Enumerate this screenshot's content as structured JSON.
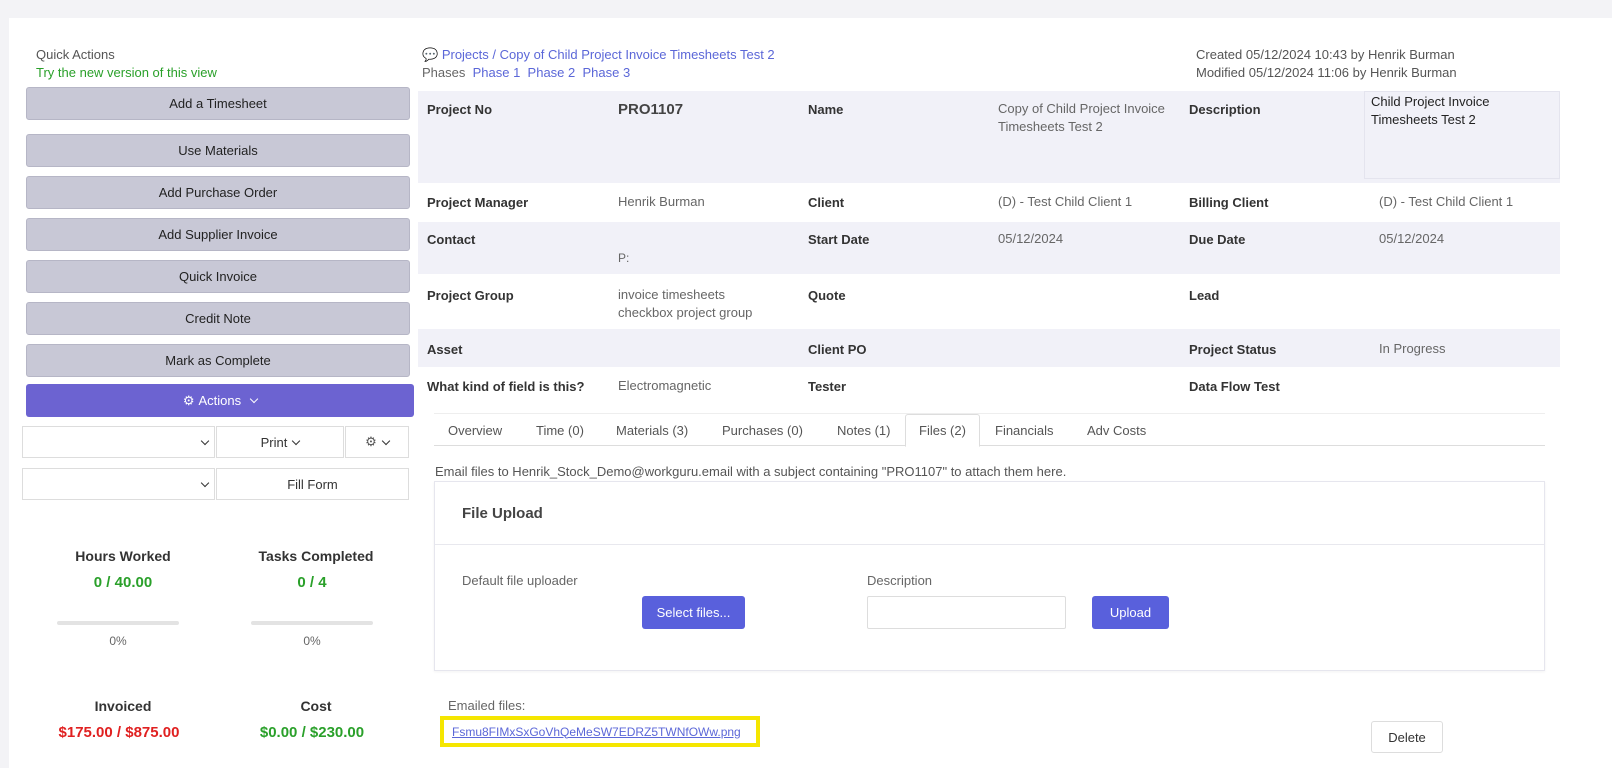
{
  "quick_actions": {
    "title": "Quick Actions",
    "try_new": "Try the new version of this view",
    "buttons": [
      "Add a Timesheet",
      "Use Materials",
      "Add Purchase Order",
      "Add Supplier Invoice",
      "Quick Invoice",
      "Credit Note",
      "Mark as Complete"
    ],
    "actions_label": "Actions",
    "print_label": "Print",
    "fill_form_label": "Fill Form"
  },
  "stats": {
    "hours_worked": {
      "label": "Hours Worked",
      "value": "0 / 40.00",
      "pct": "0%"
    },
    "tasks_completed": {
      "label": "Tasks Completed",
      "value": "0 / 4",
      "pct": "0%"
    },
    "invoiced": {
      "label": "Invoiced",
      "value": "$175.00 / $875.00"
    },
    "cost": {
      "label": "Cost",
      "value": "$0.00 / $230.00"
    }
  },
  "header": {
    "breadcrumb": "Projects / Copy of Child Project Invoice Timesheets Test 2",
    "phases_label": "Phases",
    "phases": [
      "Phase 1",
      "Phase 2",
      "Phase 3"
    ],
    "created": "Created 05/12/2024 10:43 by Henrik Burman",
    "modified": "Modified 05/12/2024 11:06 by Henrik Burman"
  },
  "details": {
    "project_no_label": "Project No",
    "project_no": "PRO1107",
    "name_label": "Name",
    "name": "Copy of Child Project Invoice Timesheets Test 2",
    "description_label": "Description",
    "description": "Child Project Invoice Timesheets Test 2",
    "manager_label": "Project Manager",
    "manager": "Henrik Burman",
    "client_label": "Client",
    "client": "(D) - Test Child Client 1",
    "billing_client_label": "Billing Client",
    "billing_client": "(D) - Test Child Client 1",
    "contact_label": "Contact",
    "contact_phone": "P:",
    "start_date_label": "Start Date",
    "start_date": "05/12/2024",
    "due_date_label": "Due Date",
    "due_date": "05/12/2024",
    "group_label": "Project Group",
    "group_1": "invoice timesheets",
    "group_2": "checkbox project group",
    "quote_label": "Quote",
    "lead_label": "Lead",
    "asset_label": "Asset",
    "client_po_label": "Client PO",
    "status_label": "Project Status",
    "status": "In Progress",
    "field_kind_label": "What kind of field is this?",
    "field_kind": "Electromagnetic",
    "tester_label": "Tester",
    "data_flow_label": "Data Flow Test"
  },
  "tabs": [
    "Overview",
    "Time (0)",
    "Materials (3)",
    "Purchases (0)",
    "Notes (1)",
    "Files (2)",
    "Financials",
    "Adv Costs"
  ],
  "files": {
    "email_note": "Email files to Henrik_Stock_Demo@workguru.email with a subject containing \"PRO1107\" to attach them here.",
    "upload_title": "File Upload",
    "default_uploader": "Default file uploader",
    "select_files": "Select files...",
    "description_label": "Description",
    "upload_btn": "Upload",
    "emailed_label": "Emailed files:",
    "emailed_file": "Fsmu8FIMxSxGoVhQeMeSW7EDRZ5TWNfOWw.png",
    "delete_btn": "Delete"
  },
  "colors": {
    "accent": "#6c63d1",
    "link": "#5b67d8",
    "green": "#2aa02a",
    "red": "#e02020",
    "highlight": "#f5e600"
  }
}
